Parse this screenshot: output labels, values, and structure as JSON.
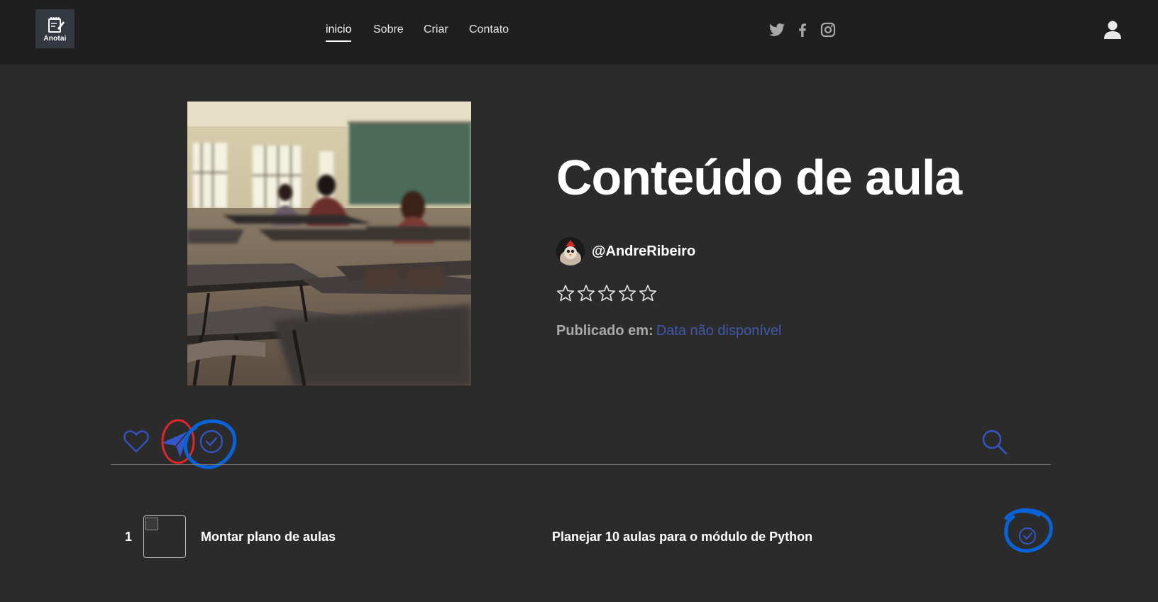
{
  "header": {
    "logo_text": "Anotai",
    "nav": [
      {
        "label": "inicio",
        "active": true
      },
      {
        "label": "Sobre"
      },
      {
        "label": "Criar"
      },
      {
        "label": "Contato"
      }
    ],
    "social_icons": [
      "twitter-icon",
      "facebook-icon",
      "instagram-icon"
    ],
    "user_icon": "user-icon"
  },
  "content": {
    "title": "Conteúdo de aula",
    "author": "@AndreRibeiro",
    "rating": {
      "value": 0,
      "max": 5
    },
    "published_label": "Publicado em:",
    "published_value": "Data não disponível"
  },
  "actions": {
    "left": [
      "heart-icon",
      "send-icon",
      "check-circle-icon"
    ],
    "right": [
      "search-icon"
    ]
  },
  "tasks": [
    {
      "number": "1",
      "title": "Montar plano de aulas",
      "description": "Planejar 10 aulas para o módulo de Python"
    }
  ],
  "colors": {
    "header_bg": "#1f1f1f",
    "page_bg": "#2b2b2b",
    "accent_blue": "#3556c9",
    "annotation_blue": "#0a63d6",
    "annotation_red": "#e0262b",
    "link_blue": "#3f58a8"
  }
}
